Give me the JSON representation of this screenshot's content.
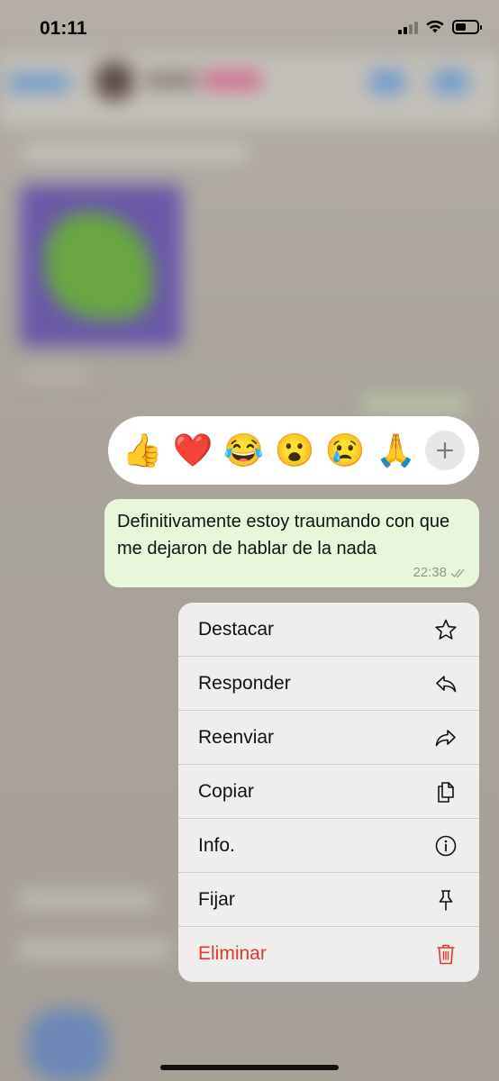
{
  "status_bar": {
    "time": "01:11"
  },
  "reactions": {
    "emojis": [
      "👍",
      "❤️",
      "😂",
      "😮",
      "😢",
      "🙏"
    ],
    "more_icon": "plus-icon"
  },
  "message": {
    "text": "Definitivamente estoy traumando con que me dejaron de hablar de la nada",
    "time": "22:38",
    "status_icon": "double-check-icon",
    "bubble_color": "#e8f7dc"
  },
  "menu": {
    "items": [
      {
        "label": "Destacar",
        "icon": "star-icon"
      },
      {
        "label": "Responder",
        "icon": "reply-icon"
      },
      {
        "label": "Reenviar",
        "icon": "forward-icon"
      },
      {
        "label": "Copiar",
        "icon": "copy-icon"
      },
      {
        "label": "Info.",
        "icon": "info-icon"
      },
      {
        "label": "Fijar",
        "icon": "pin-icon"
      },
      {
        "label": "Eliminar",
        "icon": "trash-icon",
        "color": "#e5372f"
      }
    ]
  }
}
